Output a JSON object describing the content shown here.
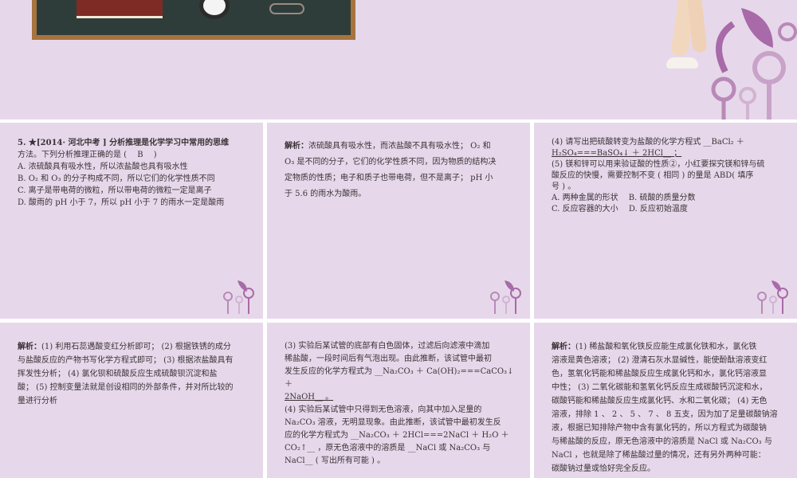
{
  "colors": {
    "panel": "#e6d8ea",
    "gap": "#ffffff",
    "text": "#3a3236",
    "deco": "#a86aa8"
  },
  "icons": {
    "hero_left": "chalkboard-books-clock-glasses",
    "hero_right": "leaf-swirl-logo",
    "panel_corner": "mini-swirl-logo"
  },
  "p1": {
    "lines": [
      "5. ★[2014· 河北中考 ] 分析推理是化学学习中常用的思维",
      "方法。下列分析推理正确的是 (　 B 　)",
      "A. 浓硫酸具有吸水性，所以浓盐酸也具有吸水性",
      "B. O₂ 和 O₃ 的分子构成不同，所以它们的化学性质不同",
      "C. 离子是带电荷的微粒，所以带电荷的微粒一定是离子",
      "D. 酸雨的 pH 小于 7，所以 pH 小于 7 的雨水一定是酸雨"
    ]
  },
  "p2": {
    "label": "解析：",
    "lines": [
      "浓硫酸具有吸水性，而浓盐酸不具有吸水性； O₂ 和",
      "O₃ 是不同的分子，它们的化学性质不同，因为物质的结构决",
      "定物质的性质；电子和质子也带电荷，但不是离子； pH 小",
      "于 5.6 的雨水为酸雨。"
    ]
  },
  "p3": {
    "lines": [
      "(4) 请写出把硫酸转变为盐酸的化学方程式 __BaCl₂ ＋",
      "H₂SO₄===BaSO₄↓ ＋ 2HCl__ ；",
      "(5) 镁和锌可以用来验证酸的性质②，小红要探究镁和锌与硫",
      "酸反应的快慢，需要控制不变 ( 相同 ) 的量是 ABD( 填序",
      "号 ) 。",
      "A. 两种金属的形状　 B. 硫酸的质量分数",
      "C. 反应容器的大小　 D. 反应初始温度"
    ]
  },
  "p4": {
    "label": "解析：",
    "lines": [
      "(1) 利用石蕊遇酸变红分析即可； (2) 根据铁锈的成分",
      "与盐酸反应的产物书写化学方程式即可； (3) 根据浓盐酸具有",
      "挥发性分析； (4) 氯化钡和硫酸反应生成硫酸钡沉淀和盐",
      "酸； (5) 控制变量法就是创设相同的外部条件，并对所比较的",
      "量进行分析"
    ]
  },
  "p5": {
    "lines": [
      "(3) 实验后某试管的底部有白色固体，过滤后向滤液中滴加",
      "稀盐酸，一段时间后有气泡出现。由此推断，该试管中最初",
      "发生反应的化学方程式为 __Na₂CO₃ ＋ Ca(OH)₂===CaCO₃↓ ＋",
      "2NaOH__ 。",
      "(4) 实验后某试管中只得到无色溶液，向其中加入足量的",
      "Na₂CO₃ 溶液，无明显现象。由此推断，该试管中最初发生反",
      "应的化学方程式为 __Na₂CO₃ ＋ 2HCl===2NaCl ＋ H₂O ＋",
      "CO₂↑__ ，原无色溶液中的溶质是 __NaCl 或 Na₂CO₃ 与",
      "NaCl__ ( 写出所有可能 ) 。"
    ]
  },
  "p6": {
    "label": "解析：",
    "lines": [
      "(1) 稀盐酸和氧化铁反应能生成氯化铁和水，氯化铁",
      "溶液是黄色溶液； (2) 澄清石灰水显碱性，能使酚酞溶液变红",
      "色，氢氧化钙能和稀盐酸反应生成氯化钙和水，氯化钙溶液显",
      "中性； (3) 二氧化碳能和氢氧化钙反应生成碳酸钙沉淀和水，",
      "碳酸钙能和稀盐酸反应生成氯化钙、水和二氧化碳； (4) 无色",
      "溶液，排除 1 、 2 、 5 、 7 、 8 五支，因为加了足量碳酸钠溶",
      "液，根据已知排除产物中含有氯化钙的，所以方程式为碳酸钠",
      "与稀盐酸的反应，原无色溶液中的溶质是 NaCl 或 Na₂CO₃ 与",
      "NaCl ，也就是除了稀盐酸过量的情况，还有另外两种可能：",
      "碳酸钠过量或恰好完全反应。"
    ]
  }
}
